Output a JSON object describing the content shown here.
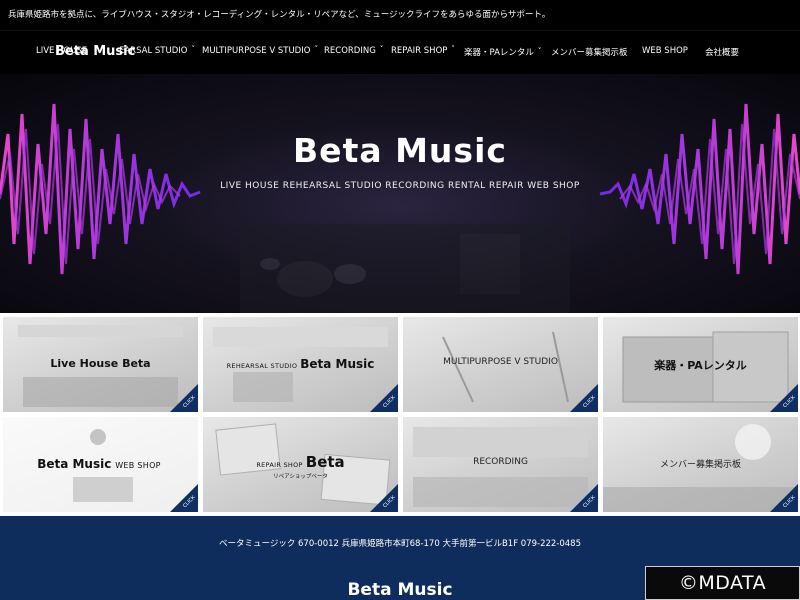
{
  "header": {
    "tagline": "兵庫県姫路市を拠点に、ライブハウス・スタジオ・レコーディング・レンタル・リペアなど、ミュージックライフをあらゆる面からサポート。",
    "logo": "Beta Music"
  },
  "nav": {
    "items": [
      {
        "label": "LIVE HOUSE",
        "has_dropdown": false
      },
      {
        "label": "EARSAL STUDIO",
        "has_dropdown": true
      },
      {
        "label": "MULTIPURPOSE V STUDIO",
        "has_dropdown": true
      },
      {
        "label": "RECORDING",
        "has_dropdown": true
      },
      {
        "label": "REPAIR SHOP",
        "has_dropdown": true
      },
      {
        "label": "楽器・PAレンタル",
        "has_dropdown": true
      },
      {
        "label": "メンバー募集掲示板",
        "has_dropdown": false
      },
      {
        "label": "WEB SHOP",
        "has_dropdown": false
      },
      {
        "label": "会社概要",
        "has_dropdown": false
      }
    ],
    "chevron": "˅"
  },
  "hero": {
    "title": "Beta Music",
    "subtitle": "LIVE HOUSE   REHEARSAL STUDIO   RECORDING   RENTAL   REPAIR   WEB SHOP",
    "colors": {
      "wave_magenta": "#e23ad0",
      "wave_violet": "#8b3bff",
      "background": "#15121f"
    }
  },
  "tiles": {
    "click_label": "CLICK",
    "live_house": {
      "label": "Live House Beta"
    },
    "rehearsal": {
      "small": "REHEARSAL STUDIO",
      "big": "Beta Music"
    },
    "multipurpose": {
      "label": "MULTIPURPOSE V STUDIO"
    },
    "rental": {
      "label": "楽器・PAレンタル"
    },
    "webshop": {
      "big": "Beta Music",
      "small": "WEB SHOP"
    },
    "repair": {
      "small": "REPAIR SHOP",
      "big": "Beta",
      "sub": "リペアショップベータ"
    },
    "recording": {
      "label": "RECORDING"
    },
    "member_board": {
      "label": "メンバー募集掲示板"
    },
    "colors": {
      "click_corner": "#0f2f63"
    }
  },
  "footer": {
    "address": "ベータミュージック 670-0012 兵庫県姫路市本町68-170 大手前第一ビルB1F 079-222-0485",
    "logo": "Beta Music",
    "colors": {
      "background": "#0f2d5c"
    }
  },
  "watermark": {
    "text": "©MDATA"
  }
}
